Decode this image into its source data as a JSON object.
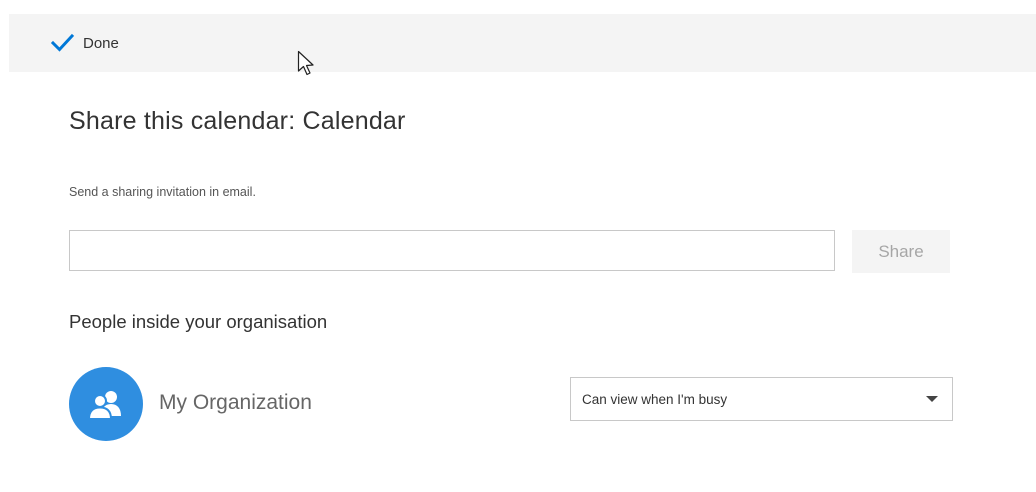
{
  "toolbar": {
    "done_label": "Done",
    "icon": "checkmark-icon",
    "accent_color": "#0078d7"
  },
  "dialog": {
    "title": "Share this calendar: Calendar",
    "subtitle": "Send a sharing invitation in email.",
    "email_input": {
      "value": "",
      "placeholder": ""
    },
    "share_label": "Share"
  },
  "internal": {
    "heading": "People inside your organisation",
    "entries": [
      {
        "name": "My Organization",
        "avatar_icon": "people-icon",
        "avatar_color": "#2f8ee0",
        "permission": "Can view when I'm busy"
      }
    ]
  }
}
